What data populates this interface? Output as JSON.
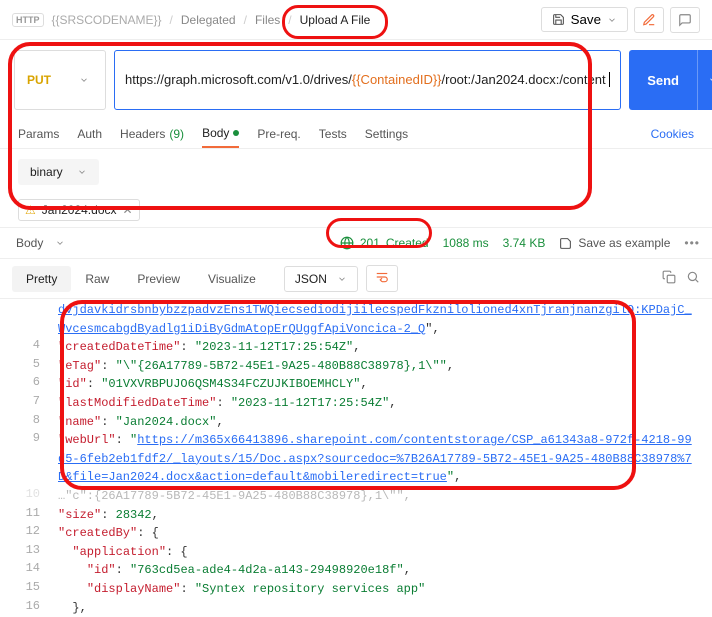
{
  "breadcrumbs": {
    "codename": "{{SRSCODENAME}}",
    "delegated": "Delegated",
    "files": "Files",
    "current": "Upload A File"
  },
  "top_actions": {
    "save": "Save"
  },
  "request": {
    "method": "PUT",
    "url_pre": "https://graph.microsoft.com/v1.0/drives/",
    "url_var": "{{ContainedID}}",
    "url_post": "/root:/Jan2024.docx:/content",
    "send": "Send"
  },
  "tabs": {
    "params": "Params",
    "auth": "Auth",
    "headers": "Headers",
    "headers_count": "(9)",
    "body": "Body",
    "prereq": "Pre-req.",
    "tests": "Tests",
    "settings": "Settings",
    "cookies": "Cookies"
  },
  "body": {
    "type": "binary",
    "file": "Jan2024.docx"
  },
  "response": {
    "section_label": "Body",
    "status_code": "201",
    "status_text": "Created",
    "time": "1088 ms",
    "size": "3.74 KB",
    "save_example": "Save as example"
  },
  "viewtabs": {
    "pretty": "Pretty",
    "raw": "Raw",
    "preview": "Preview",
    "visualize": "Visualize",
    "format": "JSON"
  },
  "json": {
    "line3_link": "dvjdavkidrsbnbybzzpadvzEns1TWQiecsediodijiilecspedFkznilolioned4xnTjranjnanzgilQ:KPDajC_WvcesmcabgdByadlg1iDiByGdmAtopErQUggfApiVoncica-2_Q",
    "createdDateTime": {
      "key": "\"createdDateTime\"",
      "val": "\"2023-11-12T17:25:54Z\""
    },
    "eTag": {
      "key": "\"eTag\"",
      "val": "\"\\\"{26A17789-5B72-45E1-9A25-480B88C38978},1\\\"\""
    },
    "id": {
      "key": "\"id\"",
      "val": "\"01VXVRBPUJO6QSM4S34FCZUJKIBOEMHCLY\""
    },
    "lastModifiedDateTime": {
      "key": "\"lastModifiedDateTime\"",
      "val": "\"2023-11-12T17:25:54Z\""
    },
    "name": {
      "key": "\"name\"",
      "val": "\"Jan2024.docx\""
    },
    "webUrl": {
      "key": "\"webUrl\"",
      "val": "https://m365x66413896.sharepoint.com/contentstorage/CSP_a61343a8-972f-4218-99d5-6feb2eb1fdf2/_layouts/15/Doc.aspx?sourcedoc=%7B26A17789-5B72-45E1-9A25-480B88C38978%7D&file=Jan2024.docx&action=default&mobileredirect=true"
    },
    "line10_dim": "…\"c\":{26A17789-5B72-45E1-9A25-480B88C38978},1\\\"\",",
    "size": {
      "key": "\"size\"",
      "val": "28342"
    },
    "createdBy": {
      "key": "\"createdBy\""
    },
    "application": {
      "key": "\"application\""
    },
    "appId": {
      "key": "\"id\"",
      "val": "\"763cd5ea-ade4-4d2a-a143-29498920e18f\""
    },
    "displayName": {
      "key": "\"displayName\"",
      "val": "\"Syntex repository services app\""
    }
  }
}
